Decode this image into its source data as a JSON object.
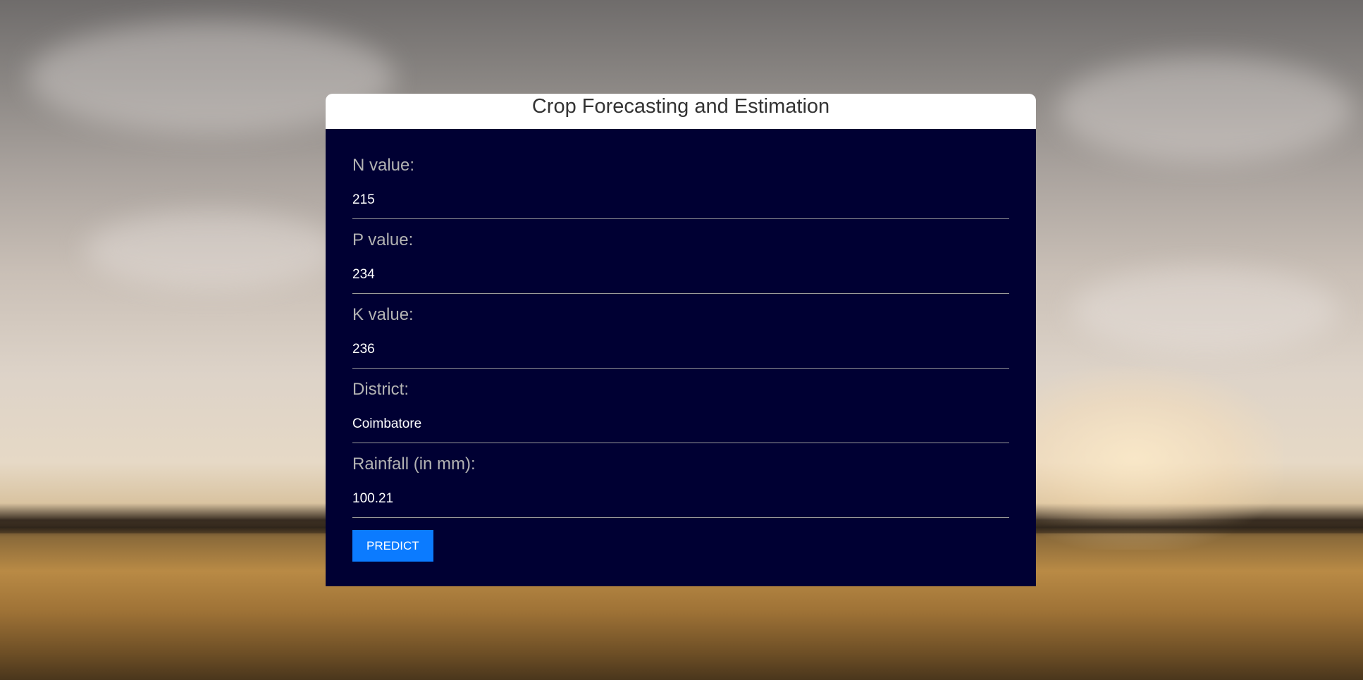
{
  "page": {
    "title": "Crop Forecasting and Estimation"
  },
  "form": {
    "fields": [
      {
        "label": "N value:",
        "value": "215"
      },
      {
        "label": "P value:",
        "value": "234"
      },
      {
        "label": "K value:",
        "value": "236"
      },
      {
        "label": "District:",
        "value": "Coimbatore"
      },
      {
        "label": "Rainfall (in mm):",
        "value": "100.21"
      }
    ],
    "submit_label": "PREDICT"
  },
  "colors": {
    "panel_bg": "#000033",
    "button_bg": "#0b7bff",
    "header_bg": "#ffffff"
  }
}
